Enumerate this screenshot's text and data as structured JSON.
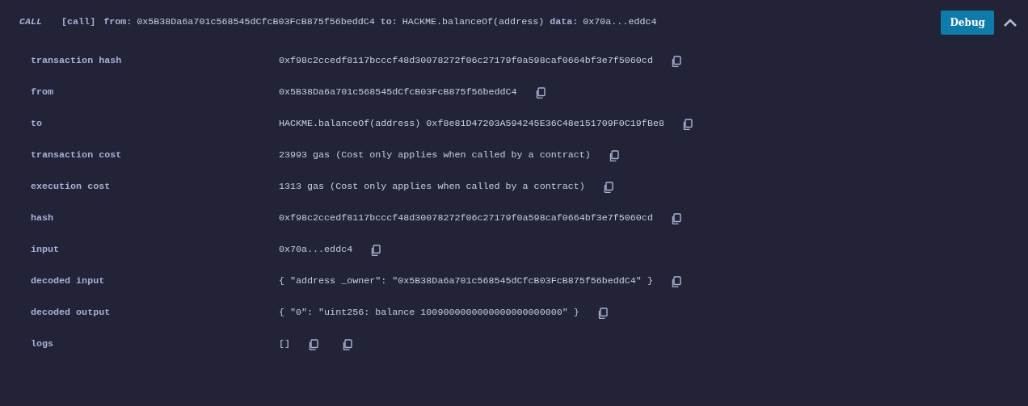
{
  "header": {
    "type_label": "CALL",
    "call_label": "[call]",
    "parts": [
      {
        "key": "from:",
        "value": "0x5B38Da6a701c568545dCfcB03FcB875f56beddC4"
      },
      {
        "key": "to:",
        "value": "HACKME.balanceOf(address)"
      },
      {
        "key": "data:",
        "value": "0x70a...eddc4"
      }
    ],
    "debug_button": "Debug",
    "expanded": true
  },
  "rows": [
    {
      "kind": "field",
      "label": "transaction hash",
      "value": "0xf98c2ccedf8117bcccf48d30078272f06c27179f0a598caf0664bf3e7f5060cd"
    },
    {
      "kind": "field",
      "label": "from",
      "value": "0x5B38Da6a701c568545dCfcB03FcB875f56beddC4"
    },
    {
      "kind": "field",
      "label": "to",
      "value": "HACKME.balanceOf(address) 0xf8e81D47203A594245E36C48e151709F0C19fBe8"
    },
    {
      "kind": "field",
      "label": "transaction cost",
      "value": "23993 gas (Cost only applies when called by a contract)"
    },
    {
      "kind": "field",
      "label": "execution cost",
      "value": "1313 gas (Cost only applies when called by a contract)"
    },
    {
      "kind": "field",
      "label": "hash",
      "value": "0xf98c2ccedf8117bcccf48d30078272f06c27179f0a598caf0664bf3e7f5060cd"
    },
    {
      "kind": "field",
      "label": "input",
      "value": "0x70a...eddc4"
    },
    {
      "kind": "field",
      "label": "decoded input",
      "value": "{ \"address _owner\": \"0x5B38Da6a701c568545dCfcB03FcB875f56beddC4\" }"
    },
    {
      "kind": "field",
      "label": "decoded output",
      "value": "{ \"0\": \"uint256: balance 1009000000000000000000000\" }"
    },
    {
      "kind": "logs",
      "label": "logs",
      "value": "[]"
    }
  ]
}
